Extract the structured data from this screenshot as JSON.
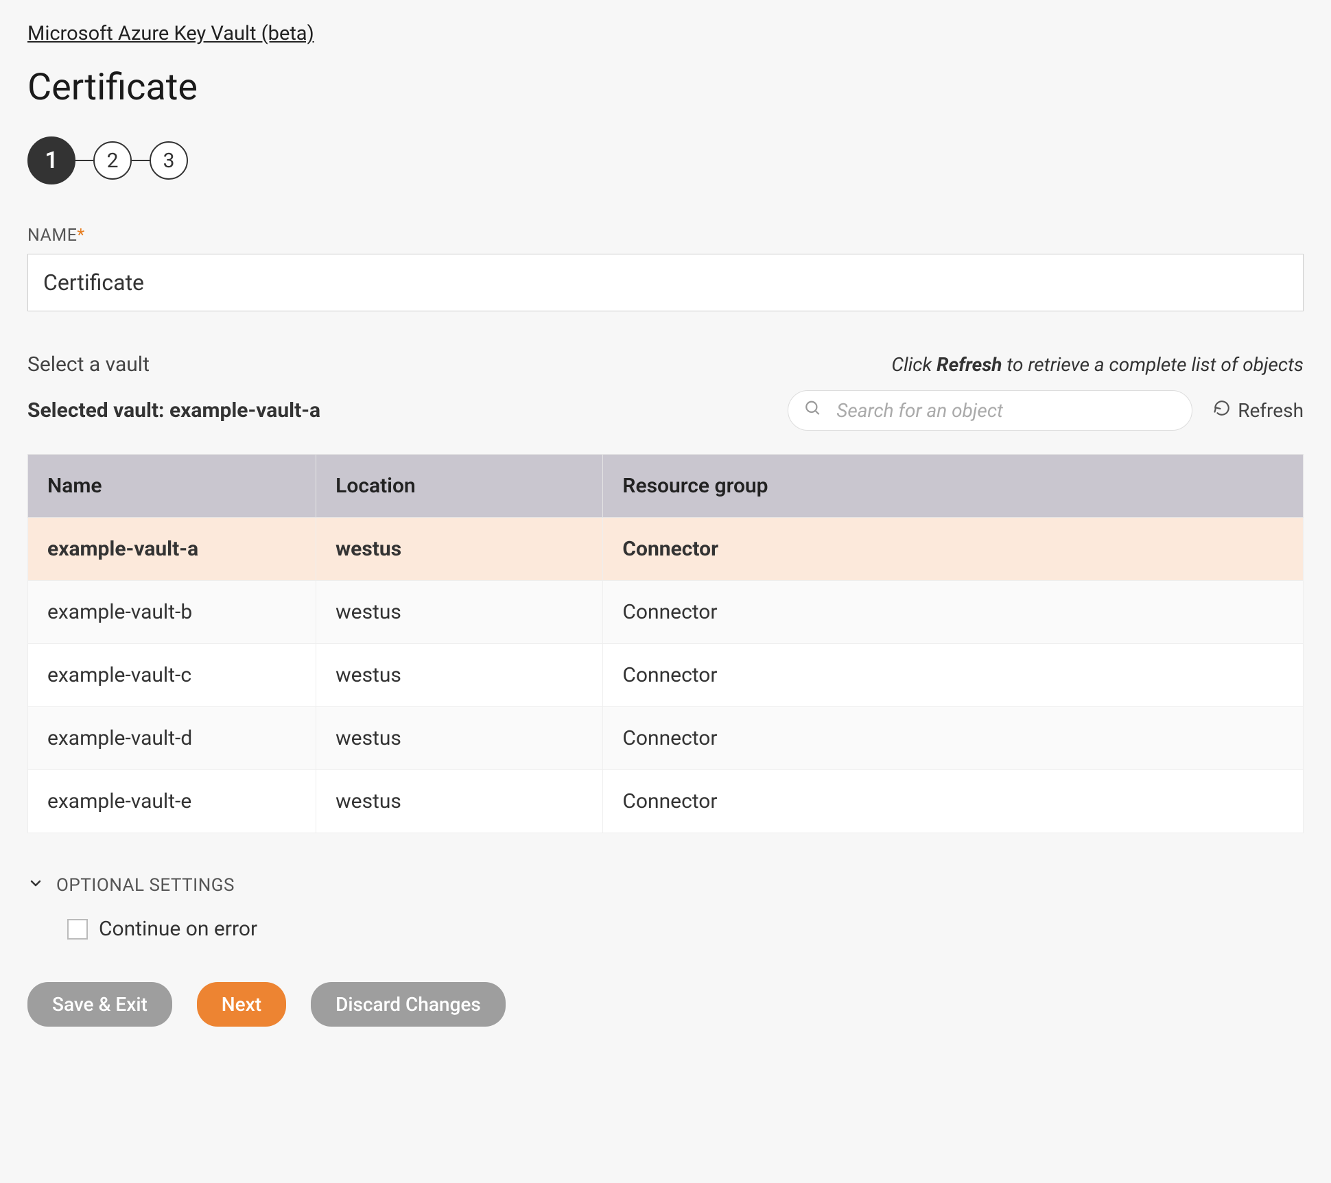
{
  "breadcrumb": "Microsoft Azure Key Vault (beta)",
  "page_title": "Certificate",
  "steps": [
    "1",
    "2",
    "3"
  ],
  "active_step_index": 0,
  "name_field": {
    "label": "NAME",
    "value": "Certificate"
  },
  "vault_section_label": "Select a vault",
  "hint_prefix": "Click ",
  "hint_bold": "Refresh",
  "hint_suffix": " to retrieve a complete list of objects",
  "selected_vault_prefix": "Selected vault: ",
  "selected_vault": "example-vault-a",
  "search_placeholder": "Search for an object",
  "refresh_label": "Refresh",
  "table": {
    "headers": [
      "Name",
      "Location",
      "Resource group"
    ],
    "rows": [
      {
        "name": "example-vault-a",
        "location": "westus",
        "group": "Connector",
        "selected": true
      },
      {
        "name": "example-vault-b",
        "location": "westus",
        "group": "Connector",
        "selected": false
      },
      {
        "name": "example-vault-c",
        "location": "westus",
        "group": "Connector",
        "selected": false
      },
      {
        "name": "example-vault-d",
        "location": "westus",
        "group": "Connector",
        "selected": false
      },
      {
        "name": "example-vault-e",
        "location": "westus",
        "group": "Connector",
        "selected": false
      }
    ]
  },
  "optional_settings_label": "OPTIONAL SETTINGS",
  "continue_on_error_label": "Continue on error",
  "buttons": {
    "save_exit": "Save & Exit",
    "next": "Next",
    "discard": "Discard Changes"
  }
}
